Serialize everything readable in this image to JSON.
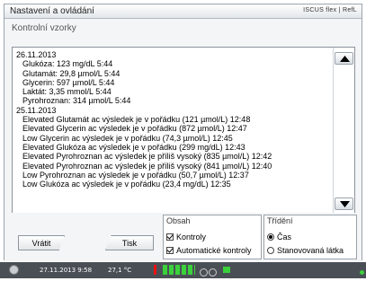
{
  "window": {
    "title": "Nastavení a ovládání",
    "logo": "ISCUS flex | RefL"
  },
  "subtitle": "Kontrolní vzorky",
  "log": [
    {
      "text": "26.11.2013",
      "indent": false
    },
    {
      "text": "Glukóza: 123 mg/dL 5:44",
      "indent": true
    },
    {
      "text": "Glutamát: 29,8 µmol/L 5:44",
      "indent": true
    },
    {
      "text": "Glycerin: 597 µmol/L 5:44",
      "indent": true
    },
    {
      "text": "Laktát: 3,35 mmol/L 5:44",
      "indent": true
    },
    {
      "text": "Pyrohroznan: 314 µmol/L 5:44",
      "indent": true
    },
    {
      "text": "25.11.2013",
      "indent": false
    },
    {
      "text": "Elevated Glutamát ac výsledek je v pořádku (121 µmol/L) 12:48",
      "indent": true
    },
    {
      "text": "Elevated Glycerin ac výsledek je v pořádku (872 µmol/L) 12:47",
      "indent": true
    },
    {
      "text": "Low Glycerin ac výsledek je v pořádku (74,3 µmol/L) 12:45",
      "indent": true
    },
    {
      "text": "Elevated Glukóza ac výsledek je v pořádku (299 mg/dL) 12:43",
      "indent": true
    },
    {
      "text": "Elevated Pyrohroznan ac výsledek je příliš vysoký (835 µmol/L) 12:42",
      "indent": true
    },
    {
      "text": "Elevated Pyrohroznan ac výsledek je příliš vysoký (841 µmol/L) 12:40",
      "indent": true
    },
    {
      "text": "Low Pyrohroznan ac výsledek je v pořádku (50,7 µmol/L) 12:37",
      "indent": true
    },
    {
      "text": "Low Glukóza ac výsledek je v pořádku (23,4 mg/dL) 12:35",
      "indent": true
    }
  ],
  "buttons": {
    "back": "Vrátit",
    "print": "Tisk"
  },
  "content_group": {
    "label": "Obsah",
    "options": [
      {
        "label": "Kontroly",
        "checked": true
      },
      {
        "label": "Automatické kontroly",
        "checked": true
      }
    ]
  },
  "sort_group": {
    "label": "Třídění",
    "options": [
      {
        "label": "Čas",
        "selected": true
      },
      {
        "label": "Stanovovaná látka",
        "selected": false
      }
    ]
  },
  "statusbar": {
    "datetime": "27.11.2013 9:58",
    "temperature": "27,1 °C"
  },
  "colors": {
    "status_ok": "#3ad13a",
    "alert": "#e11111",
    "statusbar_bg": "#4a4f56"
  }
}
